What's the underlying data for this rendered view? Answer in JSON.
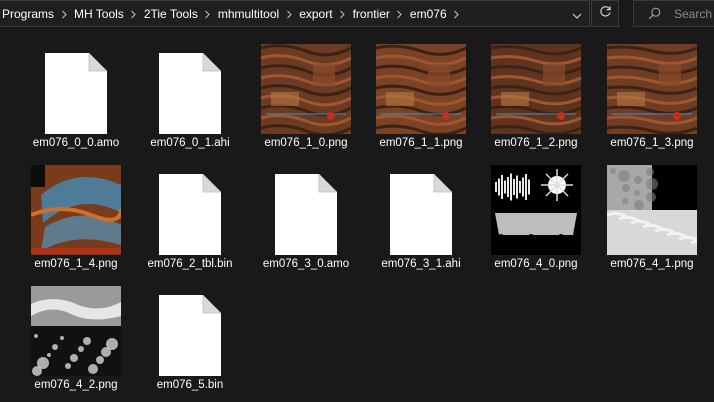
{
  "address_bar": {
    "breadcrumbs": [
      "Programs",
      "MH Tools",
      "2Tie Tools",
      "mhmultitool",
      "export",
      "frontier",
      "em076"
    ],
    "dropdown_icon": "chevron-down-icon",
    "refresh_icon": "refresh-icon"
  },
  "search": {
    "placeholder": "Search",
    "icon": "search-icon"
  },
  "colors": {
    "background": "#191919",
    "border": "#3b3b3b",
    "text": "#ffffff",
    "placeholder": "#8a8a8a"
  },
  "files": [
    {
      "name": "em076_0_0.amo",
      "kind": "document"
    },
    {
      "name": "em076_0_1.ahi",
      "kind": "document"
    },
    {
      "name": "em076_1_0.png",
      "kind": "texture-brown"
    },
    {
      "name": "em076_1_1.png",
      "kind": "texture-brown"
    },
    {
      "name": "em076_1_2.png",
      "kind": "texture-brown"
    },
    {
      "name": "em076_1_3.png",
      "kind": "texture-brown"
    },
    {
      "name": "em076_1_4.png",
      "kind": "texture-scales"
    },
    {
      "name": "em076_2_tbl.bin",
      "kind": "document"
    },
    {
      "name": "em076_3_0.amo",
      "kind": "document"
    },
    {
      "name": "em076_3_1.ahi",
      "kind": "document"
    },
    {
      "name": "em076_4_0.png",
      "kind": "texture-mask"
    },
    {
      "name": "em076_4_1.png",
      "kind": "texture-gray"
    },
    {
      "name": "em076_4_2.png",
      "kind": "texture-smoke"
    },
    {
      "name": "em076_5.bin",
      "kind": "document"
    }
  ]
}
